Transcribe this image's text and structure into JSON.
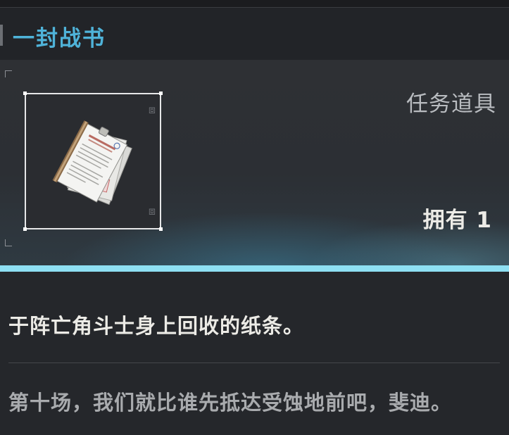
{
  "item": {
    "title": "一封战书",
    "type": "任务道具",
    "owned": "拥有 1",
    "description": "于阵亡角斗士身上回收的纸条。",
    "lore": "第十场，我们就比谁先抵达受蚀地前吧，斐迪。",
    "frame_glyph_1": "⧈",
    "frame_glyph_2": "⧈",
    "icon": "document-papers-icon"
  },
  "colors": {
    "title": "#4fb3d9",
    "accent_line": "#8ee0f3"
  }
}
